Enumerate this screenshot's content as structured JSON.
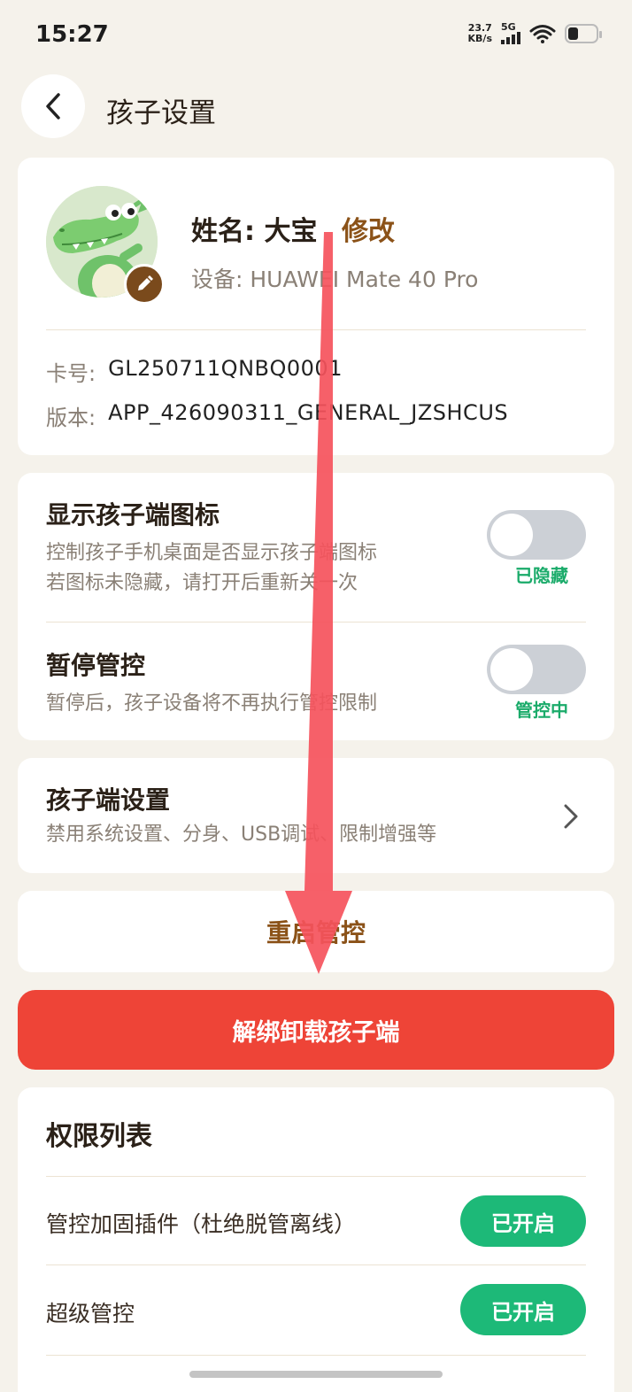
{
  "status_bar": {
    "time": "15:27",
    "net_speed_value": "23.7",
    "net_speed_unit": "KB/s",
    "network": "5G",
    "icons": [
      "signal-icon",
      "wifi-icon",
      "battery-icon"
    ]
  },
  "header": {
    "title": "孩子设置",
    "back_icon": "chevron-left-icon"
  },
  "profile": {
    "name_label": "姓名: 大宝",
    "edit_label": "修改",
    "device_label": "设备: HUAWEI Mate 40 Pro",
    "card_label": "卡号:",
    "card_value": "GL250711QNBQ0001",
    "version_label": "版本:",
    "version_value": "APP_426090311_GENERAL_JZSHCUS",
    "avatar_icon": "crocodile-avatar-icon",
    "edit_icon": "pencil-icon"
  },
  "settings": {
    "show_icon": {
      "title": "显示孩子端图标",
      "desc_line1": "控制孩子手机桌面是否显示孩子端图标",
      "desc_line2": "若图标未隐藏，请打开后重新关一次",
      "status": "已隐藏",
      "toggle_on": false
    },
    "pause_control": {
      "title": "暂停管控",
      "desc": "暂停后，孩子设备将不再执行管控限制",
      "status": "管控中",
      "toggle_on": false
    }
  },
  "child_settings": {
    "title": "孩子端设置",
    "desc": "禁用系统设置、分身、USB调试、限制增强等",
    "chevron_icon": "chevron-right-icon"
  },
  "restart": {
    "label": "重启管控"
  },
  "unbind": {
    "label": "解绑卸载孩子端"
  },
  "permissions": {
    "title": "权限列表",
    "items": [
      {
        "label": "管控加固插件（杜绝脱管离线）",
        "status": "已开启"
      },
      {
        "label": "超级管控",
        "status": "已开启"
      }
    ]
  },
  "colors": {
    "background": "#f5f2eb",
    "accent_brown": "#8b5218",
    "danger_red": "#ee4437",
    "success_green": "#1db978",
    "status_green": "#1aab6a",
    "annotation_arrow": "#f5525c"
  }
}
